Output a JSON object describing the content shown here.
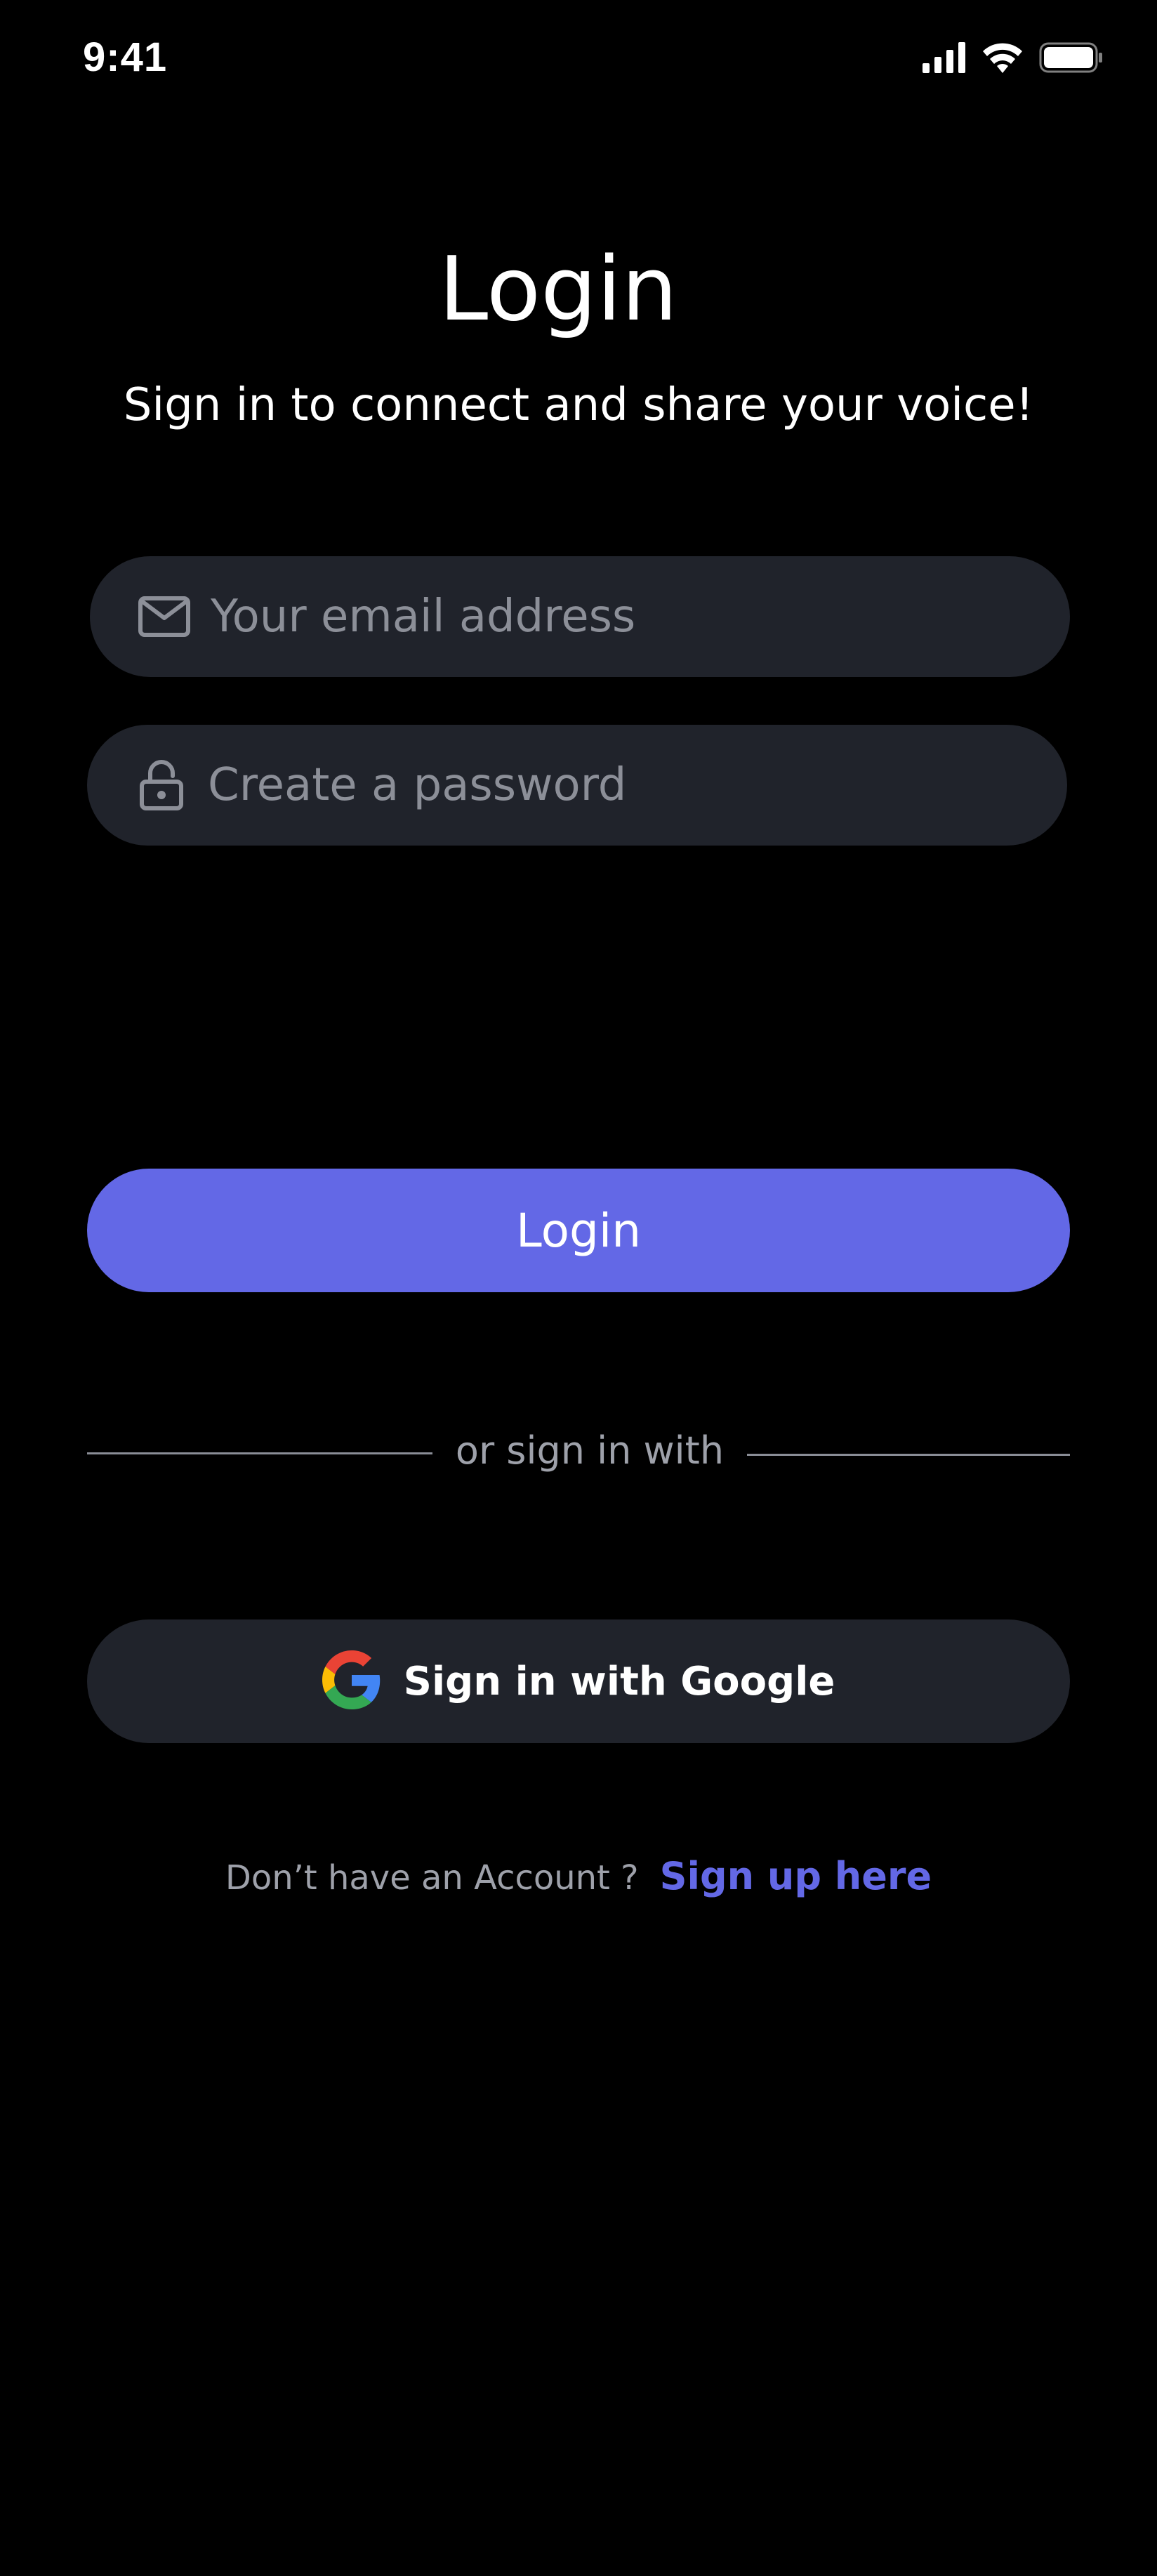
{
  "status_bar": {
    "time": "9:41",
    "icons": [
      "cellular-signal-icon",
      "wifi-icon",
      "battery-icon"
    ]
  },
  "header": {
    "title": "Login",
    "subtitle": "Sign in to connect and share your voice!"
  },
  "form": {
    "email": {
      "placeholder": "Your email address",
      "value": "",
      "icon": "mail-icon"
    },
    "password": {
      "placeholder": "Create a password",
      "value": "",
      "icon": "lock-icon"
    },
    "login_label": "Login"
  },
  "divider": {
    "text": "or sign in with"
  },
  "google": {
    "label": "Sign in with Google",
    "icon": "google-icon"
  },
  "signup": {
    "prompt": "Don’t have an Account ?",
    "link": "Sign up here"
  },
  "colors": {
    "background": "#000000",
    "field_bg": "#20232b",
    "accent": "#6368e6",
    "muted_text": "#9ea1aa",
    "placeholder": "#8c8f98"
  }
}
